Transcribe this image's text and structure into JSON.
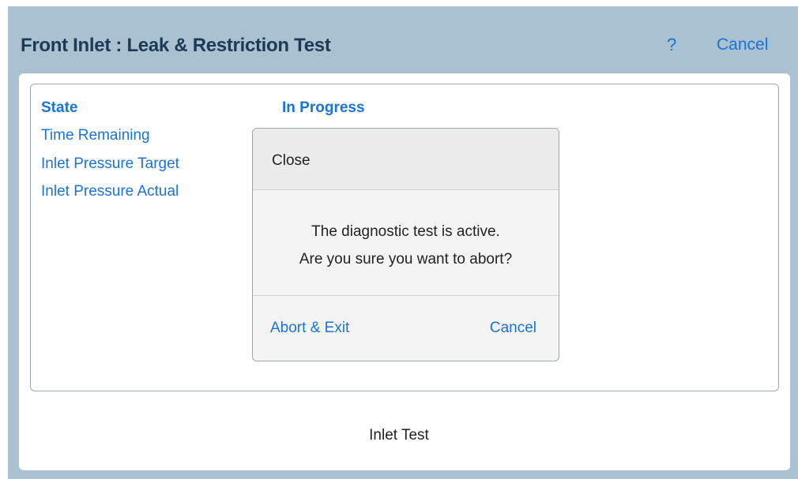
{
  "header": {
    "title": "Front Inlet : Leak & Restriction Test",
    "help_label": "?",
    "cancel_label": "Cancel"
  },
  "status": {
    "state_label": "State",
    "state_value": "In Progress",
    "time_remaining_label": "Time Remaining",
    "pressure_target_label": "Inlet Pressure Target",
    "pressure_actual_label": "Inlet Pressure Actual"
  },
  "dialog": {
    "title": "Close",
    "message_line1": "The diagnostic test is active.",
    "message_line2": "Are you sure you want to abort?",
    "abort_label": "Abort & Exit",
    "cancel_label": "Cancel"
  },
  "footer": {
    "label": "Inlet Test"
  },
  "colors": {
    "accent": "#1a73d9",
    "header_bg": "#a9c1d1",
    "title_text": "#1d3a55"
  }
}
